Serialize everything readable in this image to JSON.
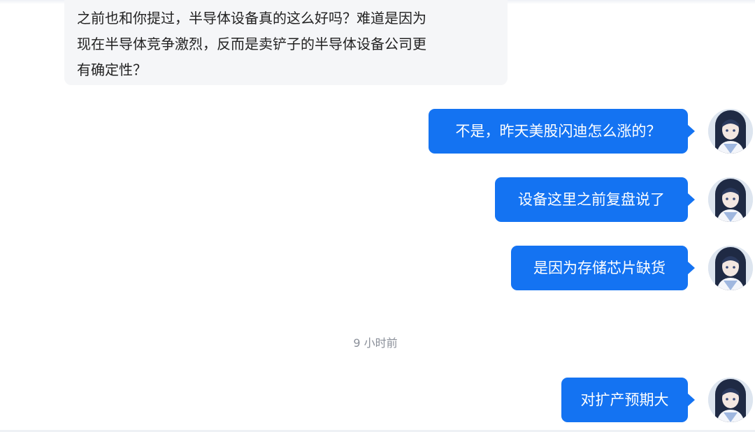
{
  "conversation": {
    "incoming_message": "之前也和你提过，半导体设备真的这么好吗？难道是因为\n现在半导体竞争激烈，反而是卖铲子的半导体设备公司更\n有确定性？",
    "outgoing_messages": [
      {
        "text": "不是，昨天美股闪迪怎么涨的？"
      },
      {
        "text": "设备这里之前复盘说了"
      },
      {
        "text": "是因为存储芯片缺货"
      },
      {
        "text": "对扩产预期大"
      }
    ],
    "timestamp": "9 小时前"
  },
  "colors": {
    "bubble_outgoing": "#1473f2",
    "bubble_incoming": "#f5f6f8",
    "timestamp_text": "#8a8f99"
  },
  "icons": {
    "avatar": "user-avatar-anime-girl"
  }
}
